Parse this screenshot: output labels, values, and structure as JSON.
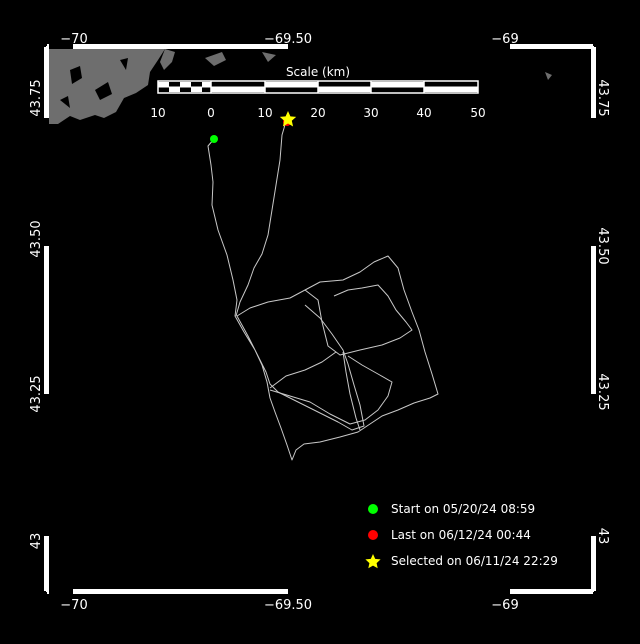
{
  "map": {
    "top_ticks": [
      "−70",
      "−69.50",
      "−69"
    ],
    "bottom_ticks": [
      "−70",
      "−69.50",
      "−69"
    ],
    "left_ticks": [
      "43.75",
      "43.50",
      "43.25",
      "43"
    ],
    "right_ticks": [
      "43.75",
      "43.50",
      "43.25",
      "43"
    ]
  },
  "scale_bar": {
    "title": "Scale (km)",
    "labels": [
      "10",
      "0",
      "10",
      "20",
      "30",
      "40",
      "50"
    ]
  },
  "legend": {
    "start": {
      "label": "Start on 05/20/24 08:59",
      "color": "#00ff00"
    },
    "last": {
      "label": "Last on 06/12/24 00:44",
      "color": "#ff0000"
    },
    "selected": {
      "label": "Selected on 06/11/24 22:29",
      "color": "#ffff00"
    }
  },
  "colors": {
    "background": "#000000",
    "frame": "#ffffff",
    "track": "#c8c8c8",
    "land": "#6e6e6e"
  }
}
